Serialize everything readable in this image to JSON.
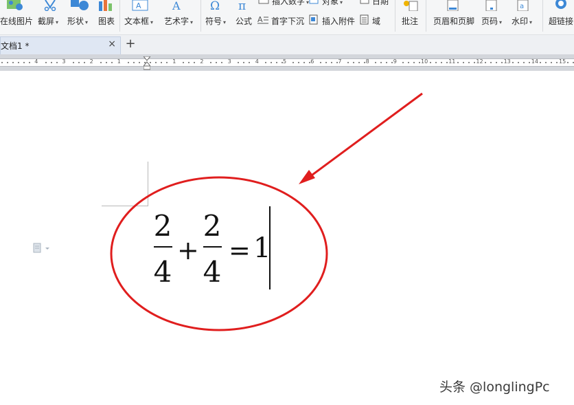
{
  "ribbon": {
    "items": [
      {
        "label": "在线图片",
        "icon": "online-picture-icon"
      },
      {
        "label": "截屏",
        "icon": "screenshot-icon"
      },
      {
        "label": "形状",
        "icon": "shapes-icon"
      },
      {
        "label": "图表",
        "icon": "chart-icon"
      },
      {
        "label": "文本框",
        "icon": "text-box-icon"
      },
      {
        "label": "艺术字",
        "icon": "word-art-icon"
      },
      {
        "label": "符号",
        "icon": "symbol-omega-icon"
      },
      {
        "label": "公式",
        "icon": "equation-pi-icon"
      },
      {
        "label": "插入数字",
        "icon": "insert-number-icon"
      },
      {
        "label": "首字下沉",
        "icon": "drop-cap-icon"
      },
      {
        "label": "对象",
        "icon": "object-icon"
      },
      {
        "label": "插入附件",
        "icon": "insert-attachment-icon"
      },
      {
        "label": "日期",
        "icon": "date-icon"
      },
      {
        "label": "域",
        "icon": "field-icon"
      },
      {
        "label": "批注",
        "icon": "comment-icon"
      },
      {
        "label": "页眉和页脚",
        "icon": "header-footer-icon"
      },
      {
        "label": "页码",
        "icon": "page-number-icon"
      },
      {
        "label": "水印",
        "icon": "watermark-icon"
      },
      {
        "label": "超链接",
        "icon": "hyperlink-icon"
      }
    ]
  },
  "tabs": {
    "doc_tab_label": "文档1 *",
    "close_glyph": "×",
    "new_tab_glyph": "+"
  },
  "ruler": {
    "labels": [
      "4",
      "3",
      "2",
      "1",
      "1",
      "2",
      "3",
      "4",
      "5",
      "6",
      "7",
      "8",
      "9",
      "10",
      "11",
      "12",
      "13",
      "14",
      "15"
    ]
  },
  "document": {
    "equation": {
      "frac1_num": "2",
      "frac1_den": "4",
      "plus": "+",
      "frac2_num": "2",
      "frac2_den": "4",
      "equals": "=",
      "result": "1"
    }
  },
  "annotation": {
    "color": "#e01e1e"
  },
  "watermark": "头条 @longlingPc",
  "colors": {
    "ribbon_bg": "#f5f6f7",
    "tab_active_bg": "#dfe7f3",
    "ruler_bg": "#d3d6db",
    "accent_blue": "#2f6fbf"
  }
}
